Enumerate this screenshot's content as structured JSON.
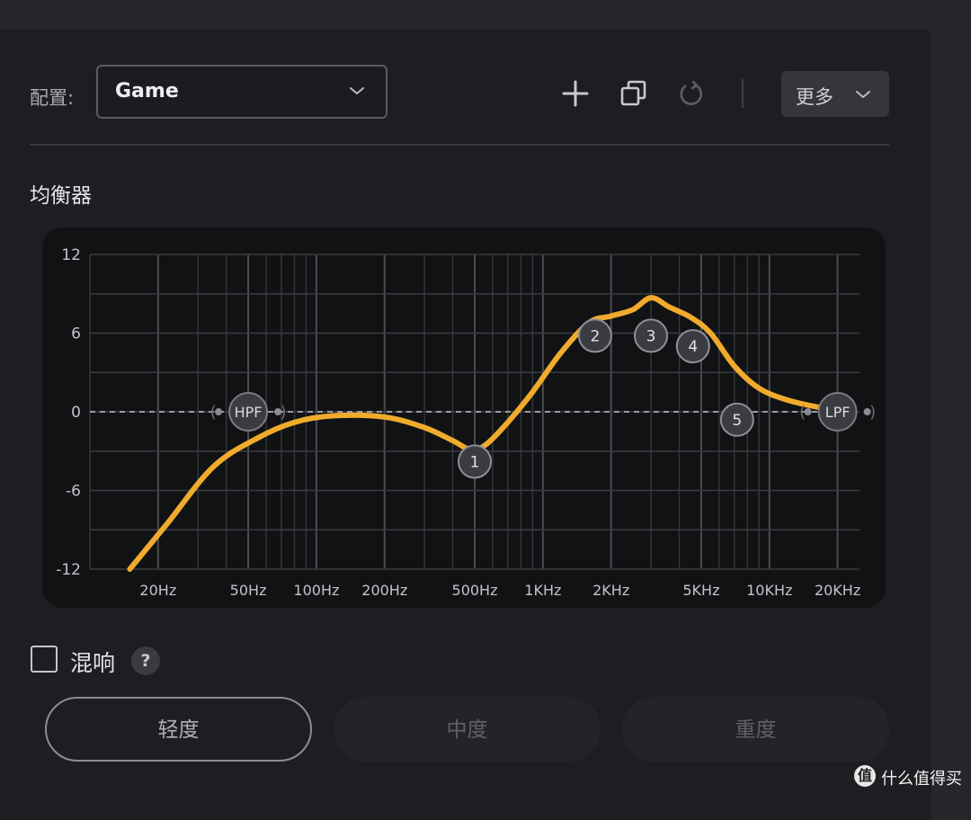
{
  "config": {
    "label": "配置:",
    "selected_preset": "Game"
  },
  "toolbar": {
    "add_icon": "plus-icon",
    "copy_icon": "copy-icon",
    "reset_icon": "reset-icon",
    "more_label": "更多"
  },
  "equalizer": {
    "title": "均衡器",
    "hpf_label": "HPF",
    "lpf_label": "LPF"
  },
  "chart_data": {
    "type": "line",
    "ylim": [
      -12,
      12
    ],
    "yticks": [
      12,
      6,
      0,
      -6,
      -12
    ],
    "x_tick_labels": [
      "20Hz",
      "50Hz",
      "100Hz",
      "200Hz",
      "500Hz",
      "1KHz",
      "2KHz",
      "5KHz",
      "10KHz",
      "20KHz"
    ],
    "x_tick_freqs": [
      20,
      50,
      100,
      200,
      500,
      1000,
      2000,
      5000,
      10000,
      20000
    ],
    "xlim_hz": [
      10,
      25000
    ],
    "log_x": true,
    "grid": true,
    "curve_color": "#f0ab2c",
    "curve": [
      {
        "f": 15,
        "g": -12.0
      },
      {
        "f": 22,
        "g": -8.5
      },
      {
        "f": 35,
        "g": -4.2
      },
      {
        "f": 55,
        "g": -2.0
      },
      {
        "f": 80,
        "g": -0.8
      },
      {
        "f": 120,
        "g": -0.3
      },
      {
        "f": 200,
        "g": -0.4
      },
      {
        "f": 300,
        "g": -1.2
      },
      {
        "f": 400,
        "g": -2.2
      },
      {
        "f": 480,
        "g": -2.9
      },
      {
        "f": 560,
        "g": -2.5
      },
      {
        "f": 700,
        "g": -0.8
      },
      {
        "f": 900,
        "g": 1.5
      },
      {
        "f": 1200,
        "g": 4.5
      },
      {
        "f": 1600,
        "g": 6.8
      },
      {
        "f": 2000,
        "g": 7.3
      },
      {
        "f": 2500,
        "g": 7.8
      },
      {
        "f": 3000,
        "g": 8.7
      },
      {
        "f": 3600,
        "g": 8.0
      },
      {
        "f": 4500,
        "g": 7.2
      },
      {
        "f": 5500,
        "g": 6.0
      },
      {
        "f": 7000,
        "g": 3.5
      },
      {
        "f": 9000,
        "g": 1.8
      },
      {
        "f": 12000,
        "g": 0.9
      },
      {
        "f": 17000,
        "g": 0.3
      },
      {
        "f": 21000,
        "g": 0.1
      }
    ],
    "bands": [
      {
        "label": "1",
        "f": 500,
        "g": -3.8
      },
      {
        "label": "2",
        "f": 1700,
        "g": 5.8
      },
      {
        "label": "3",
        "f": 3000,
        "g": 5.8
      },
      {
        "label": "4",
        "f": 4600,
        "g": 5.0
      },
      {
        "label": "5",
        "f": 7200,
        "g": -0.6
      }
    ],
    "filters": [
      {
        "label": "HPF",
        "f": 50,
        "g": 0
      },
      {
        "label": "LPF",
        "f": 20000,
        "g": 0
      }
    ]
  },
  "reverb": {
    "label": "混响",
    "help": "?",
    "checked": false
  },
  "reverb_levels": {
    "light": "轻度",
    "medium": "中度",
    "heavy": "重度"
  },
  "watermark": {
    "logo": "值",
    "text": "什么值得买"
  }
}
